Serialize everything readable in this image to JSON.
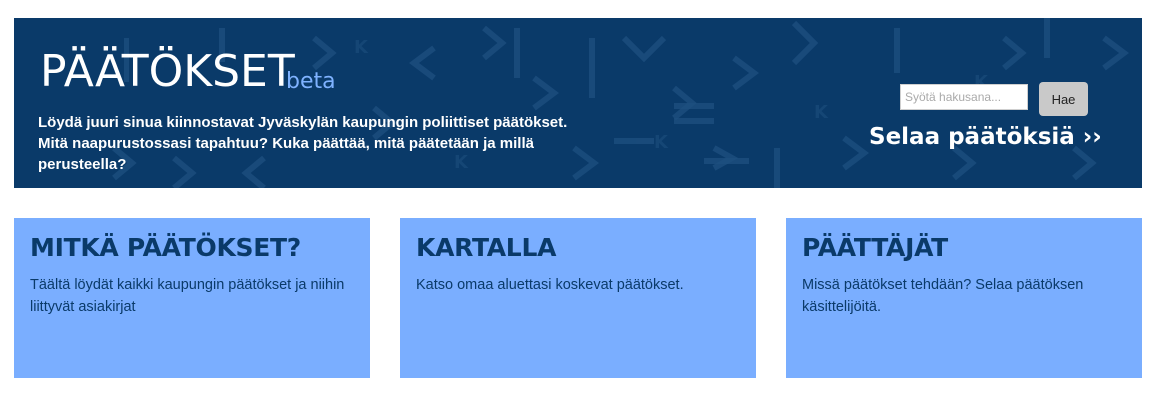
{
  "header": {
    "logo_text": "PÄÄTÖKSET",
    "beta_label": "beta",
    "description": "Löydä juuri sinua kiinnostavat Jyväskylän kaupungin poliittiset päätökset. Mitä naapurustossasi tapahtuu? Kuka päättää, mitä päätetään ja millä perusteella?",
    "search": {
      "placeholder": "Syötä hakusana...",
      "value": "",
      "button_label": "Hae"
    },
    "browse_link_label": "Selaa päätöksiä ››"
  },
  "cards": [
    {
      "title": "MITKÄ PÄÄTÖKSET?",
      "text": "Täältä löydät kaikki kaupungin päätökset ja niihin liittyvät asiakirjat"
    },
    {
      "title": "KARTALLA",
      "text": "Katso omaa aluettasi koskevat päätökset."
    },
    {
      "title": "PÄÄTTÄJÄT",
      "text": "Missä päätökset tehdään? Selaa päätöksen käsittelijöitä."
    }
  ],
  "colors": {
    "hero_bg": "#0a3a69",
    "card_bg": "#7aaeff",
    "card_text": "#0a3a69",
    "beta": "#7fb2ff"
  }
}
